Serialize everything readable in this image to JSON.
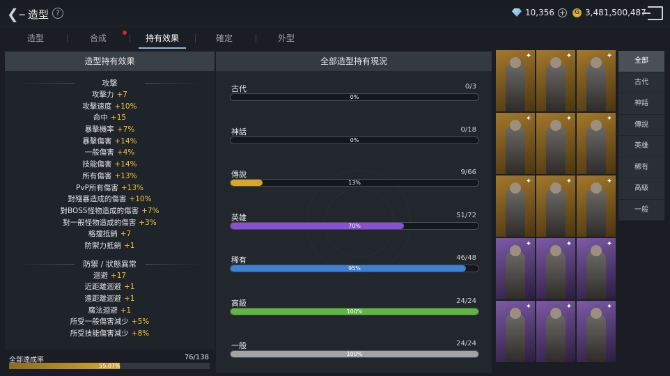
{
  "header": {
    "title": "造型",
    "help_label": "?",
    "diamonds": "10,356",
    "gold": "3,481,500,487",
    "gold_symbol": "G"
  },
  "tabs": [
    {
      "label": "造型",
      "active": false
    },
    {
      "label": "合成",
      "active": false,
      "alert": true
    },
    {
      "label": "持有效果",
      "active": true
    },
    {
      "label": "確定",
      "active": false
    },
    {
      "label": "外型",
      "active": false
    }
  ],
  "effects_panel": {
    "title": "造型持有效果",
    "attack_title": "攻擊",
    "attack": [
      {
        "name": "攻擊力",
        "value": "+7"
      },
      {
        "name": "攻擊速度",
        "value": "+10%"
      },
      {
        "name": "命中",
        "value": "+15"
      },
      {
        "name": "暴擊機率",
        "value": "+7%"
      },
      {
        "name": "暴擊傷害",
        "value": "+14%"
      },
      {
        "name": "一般傷害",
        "value": "+4%"
      },
      {
        "name": "技能傷害",
        "value": "+14%"
      },
      {
        "name": "所有傷害",
        "value": "+13%"
      },
      {
        "name": "PvP所有傷害",
        "value": "+13%"
      },
      {
        "name": "對殘暴造成的傷害",
        "value": "+10%"
      },
      {
        "name": "對BOSS怪物造成的傷害",
        "value": "+7%"
      },
      {
        "name": "對一般怪物造成的傷害",
        "value": "+3%"
      },
      {
        "name": "格擋抵銷",
        "value": "+7"
      },
      {
        "name": "防禦力抵銷",
        "value": "+1"
      }
    ],
    "defense_title": "防禦 / 狀態異常",
    "defense": [
      {
        "name": "迴避",
        "value": "+17"
      },
      {
        "name": "近距離迴避",
        "value": "+1"
      },
      {
        "name": "遠距離迴避",
        "value": "+1"
      },
      {
        "name": "魔法迴避",
        "value": "+1"
      },
      {
        "name": "所受一般傷害減少",
        "value": "+5%"
      },
      {
        "name": "所受技能傷害減少",
        "value": "+8%"
      }
    ]
  },
  "total": {
    "label": "全部達成率",
    "count": "76/138",
    "percent_label": "55.07%",
    "fraction": 0.5507
  },
  "status_panel": {
    "title": "全部造型持有現況",
    "grades": [
      {
        "name": "古代",
        "count": "0/3",
        "percent_label": "0%",
        "fraction": 0.0,
        "color": "#c9a24a"
      },
      {
        "name": "神話",
        "count": "0/18",
        "percent_label": "0%",
        "fraction": 0.0,
        "color": "#d05050"
      },
      {
        "name": "傳說",
        "count": "9/66",
        "percent_label": "13%",
        "fraction": 0.13,
        "color": "#d9a526"
      },
      {
        "name": "英雄",
        "count": "51/72",
        "percent_label": "70%",
        "fraction": 0.7,
        "color": "#8a4fd6"
      },
      {
        "name": "稀有",
        "count": "46/48",
        "percent_label": "95%",
        "fraction": 0.95,
        "color": "#3d82d6"
      },
      {
        "name": "高級",
        "count": "24/24",
        "percent_label": "100%",
        "fraction": 1.0,
        "color": "#5fb83e"
      },
      {
        "name": "一般",
        "count": "24/24",
        "percent_label": "100%",
        "fraction": 1.0,
        "color": "#a3a3a3"
      }
    ]
  },
  "gallery": {
    "rows": [
      {
        "rarity": "legend",
        "count": 3
      },
      {
        "rarity": "legend",
        "count": 3
      },
      {
        "rarity": "legend",
        "count": 3
      },
      {
        "rarity": "hero",
        "count": 3
      },
      {
        "rarity": "hero",
        "count": 3
      }
    ],
    "legend_color": "#a3782c",
    "hero_color": "#7d5aa6"
  },
  "filters": [
    {
      "label": "全部",
      "active": true
    },
    {
      "label": "古代",
      "active": false
    },
    {
      "label": "神話",
      "active": false
    },
    {
      "label": "傳說",
      "active": false
    },
    {
      "label": "英雄",
      "active": false
    },
    {
      "label": "稀有",
      "active": false
    },
    {
      "label": "高級",
      "active": false
    },
    {
      "label": "一般",
      "active": false
    }
  ]
}
